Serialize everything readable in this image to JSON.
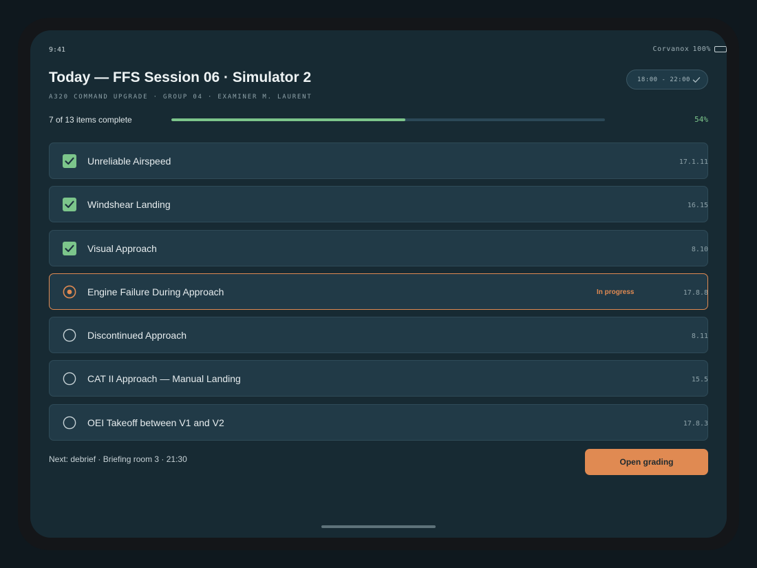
{
  "status_bar": {
    "time": "9:41",
    "carrier": "Corvanox",
    "battery": "100%",
    "battery_icon": "battery-icon"
  },
  "header": {
    "title": "Today — FFS Session 06 · Simulator 2",
    "subtitle": "A320 COMMAND UPGRADE · GROUP 04 · EXAMINER M. LAURENT",
    "time_range": "18:00 - 22:00",
    "time_icon": "check-icon"
  },
  "progress": {
    "label": "7 of 13 items complete",
    "percent_label": "54%",
    "fraction": 0.54
  },
  "items": [
    {
      "label": "Unreliable Airspeed",
      "ref": "17.1.11",
      "state": "done",
      "status": ""
    },
    {
      "label": "Windshear Landing",
      "ref": "16.15",
      "state": "done",
      "status": ""
    },
    {
      "label": "Visual Approach",
      "ref": "8.10",
      "state": "done",
      "status": ""
    },
    {
      "label": "Engine Failure During Approach",
      "ref": "17.8.8",
      "state": "active",
      "status": "In progress"
    },
    {
      "label": "Discontinued Approach",
      "ref": "8.11",
      "state": "pending",
      "status": ""
    },
    {
      "label": "CAT II Approach — Manual Landing",
      "ref": "15.5",
      "state": "pending",
      "status": ""
    },
    {
      "label": "OEI Takeoff between V1 and V2",
      "ref": "17.8.3",
      "state": "pending",
      "status": ""
    }
  ],
  "footer": {
    "next": "Next: debrief · Briefing room 3 · 21:30",
    "button": "Open grading"
  },
  "colors": {
    "accent": "#e08a52",
    "success": "#7cc58b",
    "background": "#172a33",
    "card": "#213a47"
  }
}
